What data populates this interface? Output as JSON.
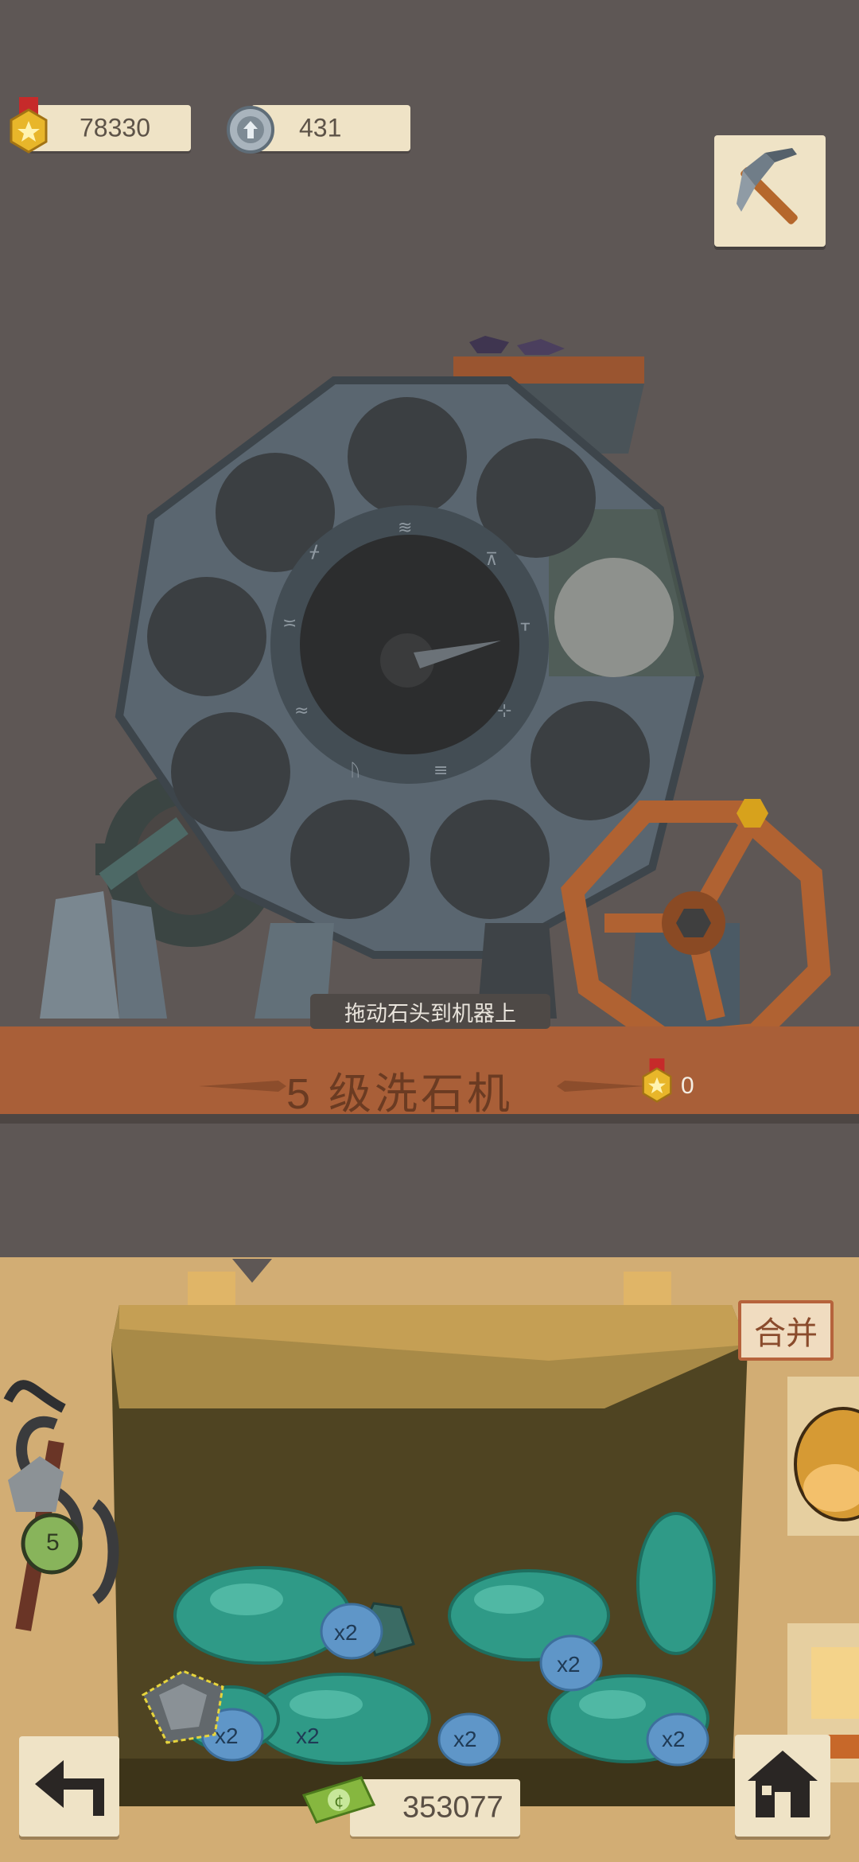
{
  "resources": {
    "medals": "78330",
    "gears": "431"
  },
  "icons": {
    "medal": "gold-medal-icon",
    "gear": "gear-coin-icon",
    "pickaxe": "pickaxe-icon",
    "back": "back-arrow-icon",
    "home": "home-icon",
    "cash": "cash-icon"
  },
  "machine": {
    "hint": "拖动石头到机器上",
    "title": "5 级洗石机",
    "reward_count": "0"
  },
  "bag": {
    "merge_label": "合并",
    "timer_badge": "5",
    "multiplier_labels": [
      "x2",
      "x2",
      "x2",
      "x2",
      "x2",
      "x2"
    ]
  },
  "footer": {
    "cash": "353077"
  },
  "colors": {
    "background": "#5e5755",
    "panel": "#d2ad74",
    "paper": "#efe3c6",
    "wood": "#a95f38",
    "gem": "#2f9a87"
  }
}
